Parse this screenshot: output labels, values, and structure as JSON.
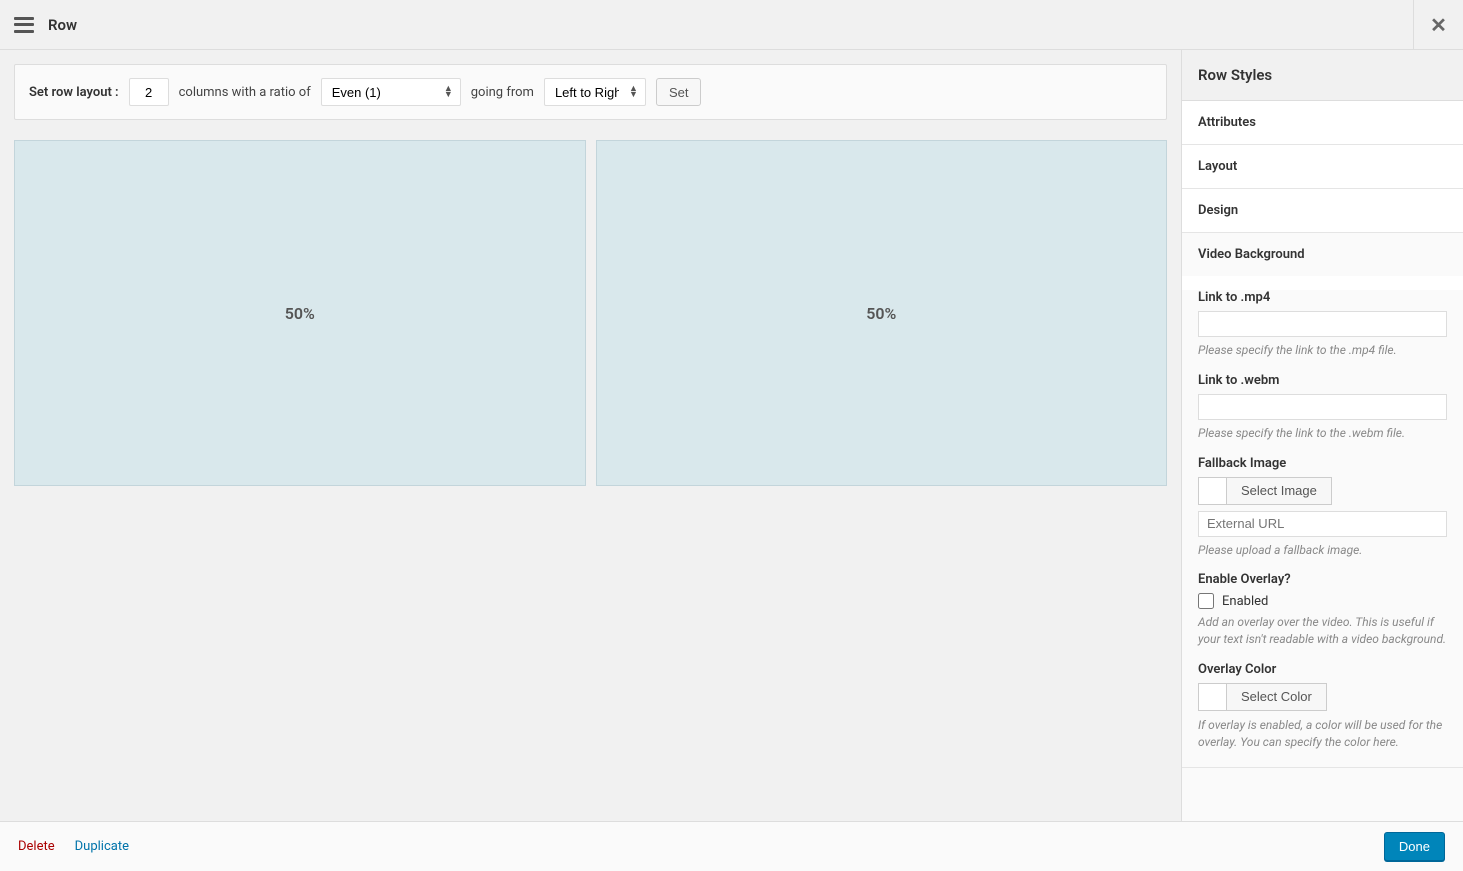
{
  "header": {
    "title": "Row"
  },
  "layoutBar": {
    "label": "Set row layout :",
    "columns_value": "2",
    "ratio_label": "columns with a ratio of",
    "ratio_selected": "Even (1)",
    "direction_label": "going from",
    "direction_selected": "Left to Right",
    "set_button": "Set"
  },
  "columns": [
    {
      "width": "50%"
    },
    {
      "width": "50%"
    }
  ],
  "sidebar": {
    "title": "Row Styles",
    "sections": {
      "attributes": "Attributes",
      "layout": "Layout",
      "design": "Design",
      "videoBackground": {
        "title": "Video Background",
        "mp4": {
          "label": "Link to .mp4",
          "value": "",
          "help": "Please specify the link to the .mp4 file."
        },
        "webm": {
          "label": "Link to .webm",
          "value": "",
          "help": "Please specify the link to the .webm file."
        },
        "fallback": {
          "label": "Fallback Image",
          "button": "Select Image",
          "external_placeholder": "External URL",
          "help": "Please upload a fallback image."
        },
        "overlay": {
          "label": "Enable Overlay?",
          "checkbox_label": "Enabled",
          "help": "Add an overlay over the video. This is useful if your text isn't readable with a video background."
        },
        "overlayColor": {
          "label": "Overlay Color",
          "button": "Select Color",
          "help": "If overlay is enabled, a color will be used for the overlay. You can specify the color here."
        }
      }
    }
  },
  "footer": {
    "delete": "Delete",
    "duplicate": "Duplicate",
    "done": "Done"
  }
}
